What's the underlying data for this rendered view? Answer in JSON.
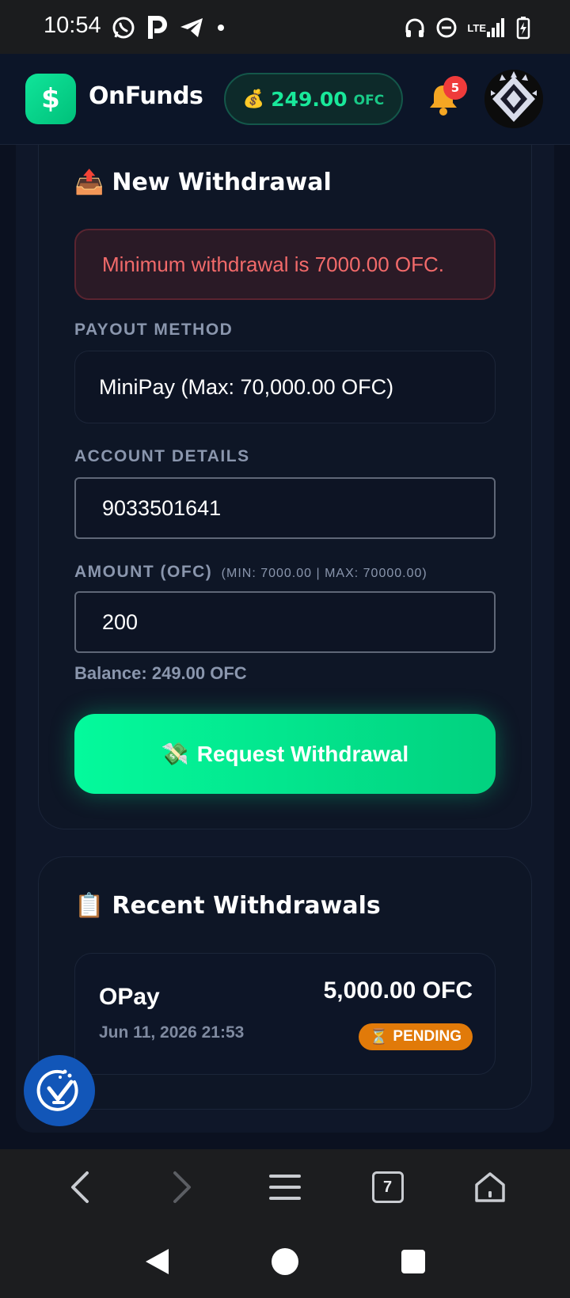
{
  "status_bar": {
    "time": "10:54",
    "network": "LTE",
    "icons_left": [
      "whatsapp-icon",
      "p-app-icon",
      "telegram-icon",
      "dot-icon"
    ],
    "icons_right": [
      "headphones-icon",
      "do-not-disturb-icon",
      "signal-icon",
      "battery-charging-icon"
    ]
  },
  "header": {
    "logo_glyph": "$",
    "brand": "OnFunds",
    "balance_emoji": "💰",
    "balance_amount": "249.00",
    "balance_unit": "OFC",
    "notification_count": "5",
    "accent": "#19e89a"
  },
  "withdraw_form": {
    "title_emoji": "📤",
    "title": "New Withdrawal",
    "alert": "Minimum withdrawal is 7000.00 OFC.",
    "payout_label": "PAYOUT METHOD",
    "payout_value": "MiniPay (Max: 70,000.00 OFC)",
    "account_label": "ACCOUNT DETAILS",
    "account_value": "9033501641",
    "amount_label": "AMOUNT (OFC)",
    "amount_hint": "(MIN: 7000.00 | MAX: 70000.00)",
    "amount_value": "200",
    "balance_prefix": "Balance:",
    "balance_value": "249.00 OFC",
    "submit_emoji": "💸",
    "submit_label": "Request Withdrawal"
  },
  "recent": {
    "title_emoji": "📋",
    "title": "Recent Withdrawals",
    "items": [
      {
        "method": "OPay",
        "date": "Jun 11, 2026 21:53",
        "amount": "5,000.00 OFC",
        "status_emoji": "⏳",
        "status": "PENDING",
        "status_color": "#e17a09"
      }
    ]
  },
  "browser_bar": {
    "tab_count": "7",
    "buttons": [
      "back-icon",
      "forward-icon",
      "menu-icon",
      "tabs-icon",
      "home-icon"
    ]
  },
  "system_nav": {
    "buttons": [
      "nav-back-icon",
      "nav-home-icon",
      "nav-recents-icon"
    ]
  }
}
